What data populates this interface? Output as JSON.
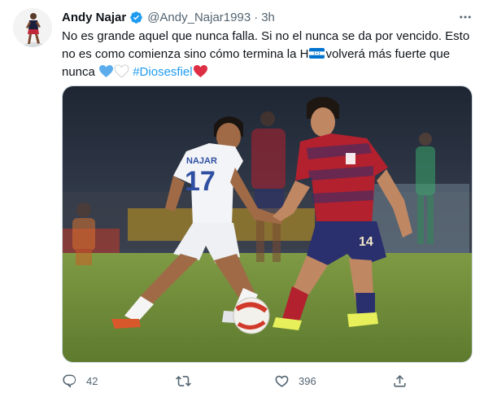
{
  "author": {
    "display_name": "Andy Najar",
    "handle": "@Andy_Najar1993",
    "separator": "·",
    "time": "3h",
    "verified": true
  },
  "tweet": {
    "line1": "No es grande aquel que nunca falla. Si no el nunca se da por vencido. Esto",
    "line2_a": "no es como comienza sino cómo termina la H",
    "line2_flag": "honduras-flag-emoji",
    "line2_b": "volverá más fuerte que",
    "line3_word": "nunca",
    "hashtag": "#Diosesfiel",
    "emojis": [
      "blue-heart",
      "white-heart",
      "red-heart"
    ]
  },
  "actions": {
    "reply_count": "42",
    "retweet_count": "",
    "like_count": "396"
  },
  "colors": {
    "accent": "#1d9bf0",
    "text": "#0f1419",
    "muted": "#536471",
    "honduras_blue": "#0073cf",
    "usa_red": "#b3202e",
    "usa_navy": "#2a2f6e",
    "pitch_green": "#6f8f3a"
  },
  "icons": {
    "verified": "verified-badge-icon",
    "more": "more-options-icon",
    "reply": "reply-icon",
    "retweet": "retweet-icon",
    "like": "like-icon",
    "share": "share-icon"
  }
}
